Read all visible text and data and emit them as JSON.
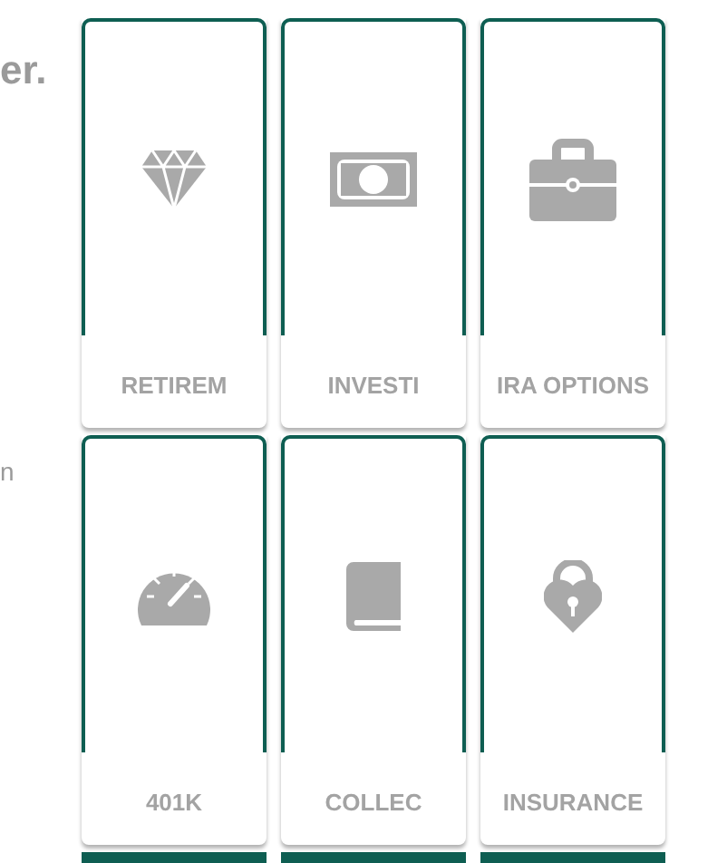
{
  "intro": {
    "heading": "er.",
    "text": "n"
  },
  "tiles": [
    {
      "label": "RETIREM"
    },
    {
      "label": "INVESTI"
    },
    {
      "label": "IRA OPTIONS"
    },
    {
      "label": "401K"
    },
    {
      "label": "COLLEC"
    },
    {
      "label": "INSURANCE"
    }
  ]
}
